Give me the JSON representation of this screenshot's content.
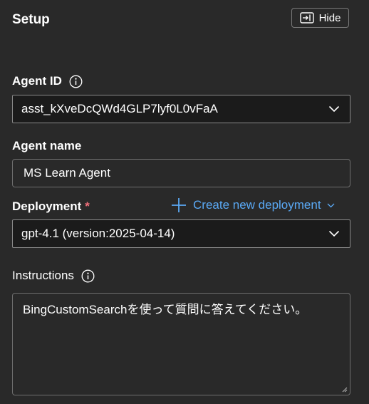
{
  "panel": {
    "title": "Setup",
    "hide_label": "Hide"
  },
  "agent_id": {
    "label": "Agent ID",
    "value": "asst_kXveDcQWd4GLP7lyf0L0vFaA"
  },
  "agent_name": {
    "label": "Agent name",
    "value": "MS Learn Agent"
  },
  "deployment": {
    "label": "Deployment",
    "required_marker": "*",
    "create_label": "Create new deployment",
    "value": "gpt-4.1 (version:2025-04-14)"
  },
  "instructions": {
    "label": "Instructions",
    "value": "BingCustomSearchを使って質問に答えてください。"
  },
  "colors": {
    "background": "#292929",
    "link": "#5aa9f5",
    "required": "#f1707b"
  },
  "icons": {
    "hide": "panel-collapse-icon",
    "info": "info-icon",
    "dropdown": "chevron-down-icon",
    "add": "plus-icon",
    "resize": "resize-grip-icon"
  }
}
